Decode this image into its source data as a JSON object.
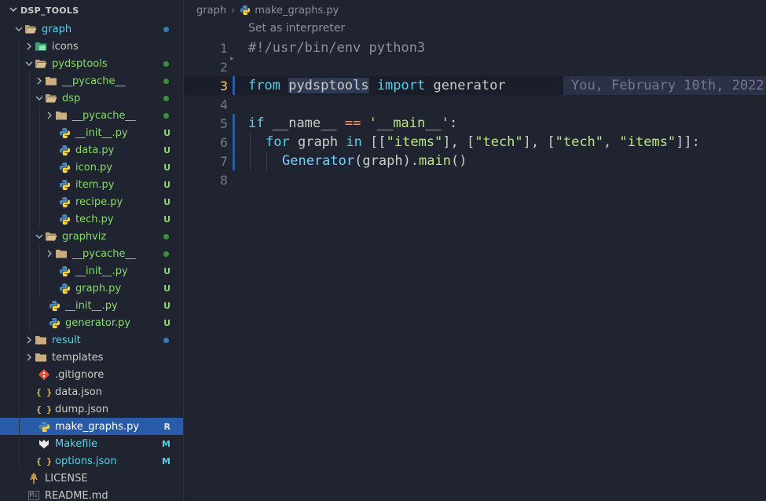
{
  "explorer": {
    "root": "DSP_TOOLS",
    "rows": [
      {
        "name": "graph",
        "kind": "folder",
        "open": true,
        "depth": 1,
        "color": "#5ccfe6",
        "mark": "dot",
        "markColor": "#2f7fb0"
      },
      {
        "name": "icons",
        "kind": "image-folder",
        "open": false,
        "depth": 2,
        "color": "#cbccc6",
        "mark": "",
        "markColor": ""
      },
      {
        "name": "pydsptools",
        "kind": "folder",
        "open": true,
        "depth": 2,
        "color": "#87d96c",
        "mark": "dot",
        "markColor": "#3c8f3c"
      },
      {
        "name": "__pycache__",
        "kind": "folder",
        "open": false,
        "depth": 3,
        "color": "#87d96c",
        "mark": "dot",
        "markColor": "#3c8f3c"
      },
      {
        "name": "dsp",
        "kind": "folder",
        "open": true,
        "depth": 3,
        "color": "#87d96c",
        "mark": "dot",
        "markColor": "#3c8f3c"
      },
      {
        "name": "__pycache__",
        "kind": "folder",
        "open": false,
        "depth": 4,
        "color": "#87d96c",
        "mark": "dot",
        "markColor": "#3c8f3c"
      },
      {
        "name": "__init__.py",
        "kind": "py",
        "depth": 4,
        "color": "#87d96c",
        "mark": "U",
        "markColor": "#87d96c"
      },
      {
        "name": "data.py",
        "kind": "py",
        "depth": 4,
        "color": "#87d96c",
        "mark": "U",
        "markColor": "#87d96c"
      },
      {
        "name": "icon.py",
        "kind": "py",
        "depth": 4,
        "color": "#87d96c",
        "mark": "U",
        "markColor": "#87d96c"
      },
      {
        "name": "item.py",
        "kind": "py",
        "depth": 4,
        "color": "#87d96c",
        "mark": "U",
        "markColor": "#87d96c"
      },
      {
        "name": "recipe.py",
        "kind": "py",
        "depth": 4,
        "color": "#87d96c",
        "mark": "U",
        "markColor": "#87d96c"
      },
      {
        "name": "tech.py",
        "kind": "py",
        "depth": 4,
        "color": "#87d96c",
        "mark": "U",
        "markColor": "#87d96c"
      },
      {
        "name": "graphviz",
        "kind": "folder",
        "open": true,
        "depth": 3,
        "color": "#87d96c",
        "mark": "dot",
        "markColor": "#3c8f3c"
      },
      {
        "name": "__pycache__",
        "kind": "folder",
        "open": false,
        "depth": 4,
        "color": "#87d96c",
        "mark": "dot",
        "markColor": "#3c8f3c"
      },
      {
        "name": "__init__.py",
        "kind": "py",
        "depth": 4,
        "color": "#87d96c",
        "mark": "U",
        "markColor": "#87d96c"
      },
      {
        "name": "graph.py",
        "kind": "py",
        "depth": 4,
        "color": "#87d96c",
        "mark": "U",
        "markColor": "#87d96c"
      },
      {
        "name": "__init__.py",
        "kind": "py",
        "depth": 3,
        "color": "#87d96c",
        "mark": "U",
        "markColor": "#87d96c"
      },
      {
        "name": "generator.py",
        "kind": "py",
        "depth": 3,
        "color": "#87d96c",
        "mark": "U",
        "markColor": "#87d96c"
      },
      {
        "name": "result",
        "kind": "folder",
        "open": false,
        "depth": 2,
        "color": "#5ccfe6",
        "mark": "dot",
        "markColor": "#2f7fb0"
      },
      {
        "name": "templates",
        "kind": "folder",
        "open": false,
        "depth": 2,
        "color": "#cbccc6",
        "mark": "",
        "markColor": ""
      },
      {
        "name": ".gitignore",
        "kind": "git",
        "depth": 2,
        "color": "#cbccc6",
        "mark": "",
        "markColor": ""
      },
      {
        "name": "data.json",
        "kind": "json",
        "depth": 2,
        "color": "#cbccc6",
        "mark": "",
        "markColor": ""
      },
      {
        "name": "dump.json",
        "kind": "json",
        "depth": 2,
        "color": "#cbccc6",
        "mark": "",
        "markColor": ""
      },
      {
        "name": "make_graphs.py",
        "kind": "py",
        "depth": 2,
        "color": "#ffffff",
        "mark": "R",
        "markColor": "#e6e6e6",
        "selected": true
      },
      {
        "name": "Makefile",
        "kind": "make",
        "depth": 2,
        "color": "#5ccfe6",
        "mark": "M",
        "markColor": "#5ccfe6"
      },
      {
        "name": "options.json",
        "kind": "json",
        "depth": 2,
        "color": "#5ccfe6",
        "mark": "M",
        "markColor": "#5ccfe6"
      },
      {
        "name": "LICENSE",
        "kind": "license",
        "depth": 1,
        "color": "#cbccc6",
        "mark": "",
        "markColor": ""
      },
      {
        "name": "README.md",
        "kind": "md",
        "depth": 1,
        "color": "#cbccc6",
        "mark": "",
        "markColor": ""
      }
    ]
  },
  "breadcrumb": {
    "folder": "graph",
    "file": "make_graphs.py"
  },
  "codelens": "Set as interpreter",
  "code": {
    "line1": "#!/usr/bin/env python3",
    "l3_from": "from",
    "l3_mod": "pydsptools",
    "l3_import": "import",
    "l3_name": "generator",
    "l5_if": "if",
    "l5_name": "__name__",
    "l5_eq": "==",
    "l5_str": "'__main__'",
    "l5_colon": ":",
    "l6_for": "for",
    "l6_var": "graph",
    "l6_in": "in",
    "l6_open": "[[",
    "l6_s1": "\"items\"",
    "l6_sep1": "], [",
    "l6_s2": "\"tech\"",
    "l6_sep2": "], [",
    "l6_s3": "\"tech\"",
    "l6_comma": ", ",
    "l6_s4": "\"items\"",
    "l6_close": "]]:",
    "l7_cls": "Generator",
    "l7_open": "(",
    "l7_arg": "graph",
    "l7_close": ").",
    "l7_fn": "main",
    "l7_paren": "()",
    "blame": "You, February 10th, 2022"
  },
  "line_numbers": [
    "1",
    "2",
    "3",
    "4",
    "5",
    "6",
    "7",
    "8"
  ]
}
